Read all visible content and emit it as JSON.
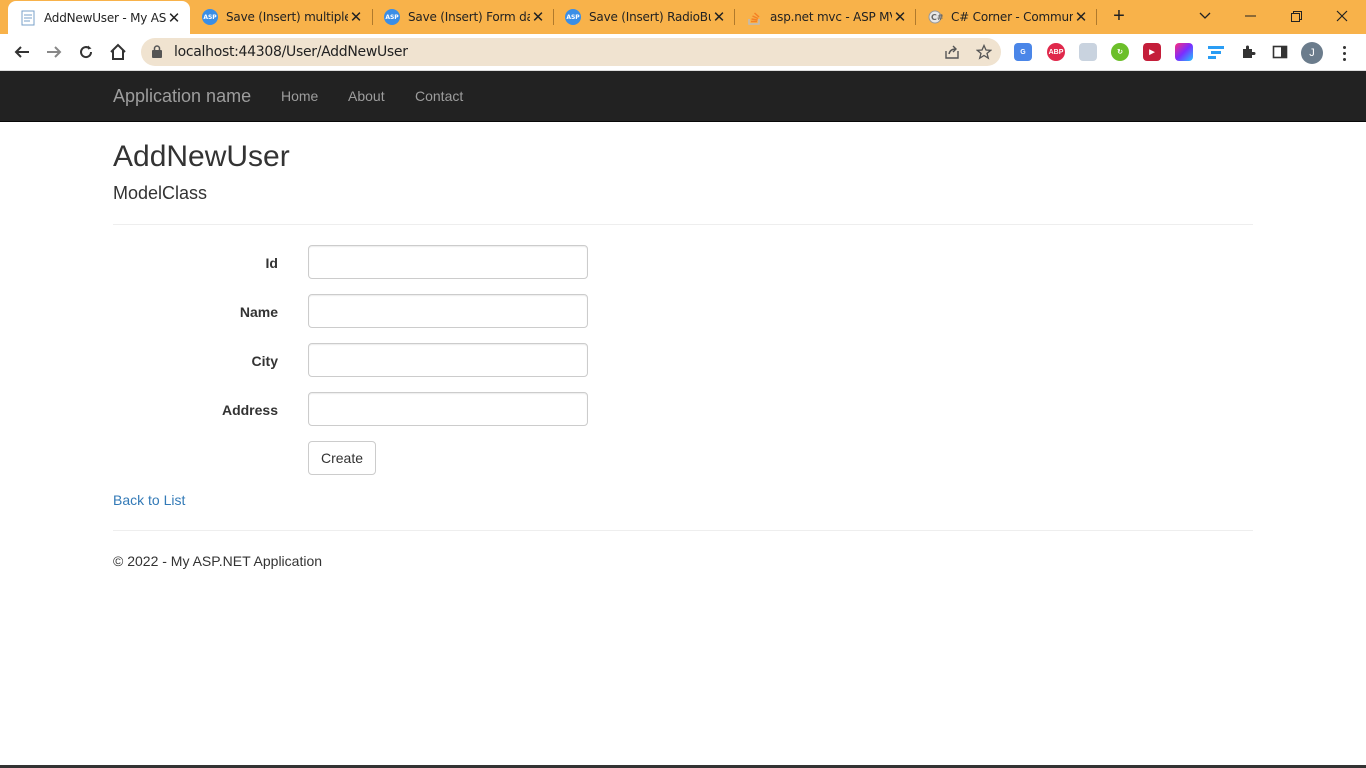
{
  "browser": {
    "tabs": [
      {
        "title": "AddNewUser - My ASP.NET Application",
        "active": true,
        "icon": "page-icon"
      },
      {
        "title": "Save (Insert) multiple CheckBox",
        "active": false,
        "icon": "asp-icon"
      },
      {
        "title": "Save (Insert) Form data",
        "active": false,
        "icon": "asp-icon"
      },
      {
        "title": "Save (Insert) RadioButton",
        "active": false,
        "icon": "asp-icon"
      },
      {
        "title": "asp.net mvc - ASP MVC",
        "active": false,
        "icon": "stackoverflow-icon"
      },
      {
        "title": "C# Corner - Community",
        "active": false,
        "icon": "csharpcorner-icon"
      }
    ],
    "url": "localhost:44308/User/AddNewUser",
    "profile_initial": "J",
    "extensions": [
      "google-translate",
      "adblock-plus",
      "image-extension",
      "green-extension",
      "red-extension",
      "colorful-extension",
      "blue-extension"
    ],
    "accent_color": "#f8b24a"
  },
  "navbar": {
    "brand": "Application name",
    "links": [
      "Home",
      "About",
      "Contact"
    ],
    "background": "#222222"
  },
  "page": {
    "title": "AddNewUser",
    "model_heading": "ModelClass",
    "fields": [
      {
        "label": "Id",
        "value": ""
      },
      {
        "label": "Name",
        "value": ""
      },
      {
        "label": "City",
        "value": ""
      },
      {
        "label": "Address",
        "value": ""
      }
    ],
    "submit_label": "Create",
    "back_link": "Back to List",
    "link_color": "#337ab7"
  },
  "footer": {
    "text": "© 2022 - My ASP.NET Application"
  }
}
